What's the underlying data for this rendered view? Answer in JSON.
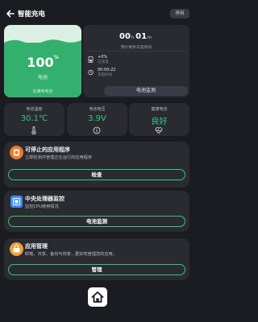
{
  "header": {
    "back_icon": "arrow-left-icon",
    "title": "智能充电",
    "stop_label": "停用"
  },
  "battery": {
    "percent": "100",
    "percent_unit": "%",
    "label": "电池",
    "state": "充满电电池",
    "color": "#34b06e"
  },
  "charge_info": {
    "hours": "00",
    "hours_unit": "h",
    "minutes": "01",
    "minutes_unit": "m",
    "caption": "预计剩余充电时间",
    "rate_value": "+0%",
    "rate_label": "已充电",
    "elapsed_value": "00:00:22",
    "elapsed_label": "充电时间",
    "button_label": "电池监测"
  },
  "stats": [
    {
      "label": "电池温度",
      "value": "30.1℃",
      "icon": "thermometer-icon"
    },
    {
      "label": "电池电压",
      "value": "3.9V",
      "icon": "info-icon"
    },
    {
      "label": "健康电池",
      "value": "良好",
      "icon": "heart-pulse-icon"
    }
  ],
  "features": [
    {
      "title": "可停止的应用程序",
      "desc": "立即检测并管理正在运行的应用程序",
      "button": "检查",
      "icon": "stop-app-icon",
      "icon_color": "#f07a2c"
    },
    {
      "title": "中央处理器监控",
      "desc": "监控CPU使用情况",
      "button": "电池监测",
      "icon": "cpu-icon",
      "icon_color": "#3f8df2"
    },
    {
      "title": "应用管理",
      "desc": "卸载、共享、备份与恢复...更好地管理您的应用。",
      "button": "管理",
      "icon": "app-manage-icon",
      "icon_color": "#f0a038"
    }
  ],
  "bottom": {
    "home_icon": "home-icon"
  },
  "colors": {
    "accent": "#2fc97a",
    "background": "#1b1c21",
    "card": "#2a2b31"
  }
}
